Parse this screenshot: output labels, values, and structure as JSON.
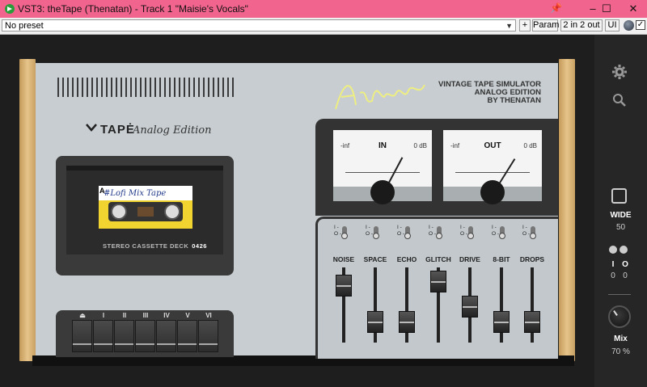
{
  "titlebar": {
    "title": "VST3: theTape (Thenatan) - Track 1 \"Maisie's Vocals\"",
    "minimize": "–",
    "maximize": "☐",
    "close": "✕",
    "pin": "📌"
  },
  "toolbar": {
    "preset": "No preset",
    "plus": "+",
    "param": "Param",
    "io": "2 in 2 out",
    "ui": "UI",
    "check": "✓"
  },
  "brand": {
    "logo": "TAPĖ",
    "edition": "Analog Edition",
    "signature": "AstroNommy",
    "vts_lines": [
      "VINTAGE TAPE SIMULATOR",
      "ANALOG EDITION",
      "BY THENATAN"
    ]
  },
  "deck": {
    "tape_label": "#Lofi Mix Tape",
    "side": "A",
    "caption": "STEREO CASSETTE DECK",
    "number": "0426"
  },
  "keys": [
    "⏏",
    "I",
    "II",
    "III",
    "IV",
    "V",
    "VI"
  ],
  "meters": [
    {
      "name": "IN",
      "min": "-inf",
      "max": "0 dB"
    },
    {
      "name": "OUT",
      "min": "-inf",
      "max": "0 dB"
    }
  ],
  "switch_labels": [
    "I -",
    "O -"
  ],
  "faders": [
    {
      "name": "NOISE",
      "level": 0.82
    },
    {
      "name": "SPACE",
      "level": 0.22
    },
    {
      "name": "ECHO",
      "level": 0.22
    },
    {
      "name": "GLITCH",
      "level": 0.88
    },
    {
      "name": "DRIVE",
      "level": 0.48
    },
    {
      "name": "8-BIT",
      "level": 0.22
    },
    {
      "name": "DROPS",
      "level": 0.22
    }
  ],
  "sidebar": {
    "wide_label": "WIDE",
    "wide_value": "50",
    "i_label": "I",
    "o_label": "O",
    "i_value": "0",
    "o_value": "0",
    "mix_label": "Mix",
    "mix_value": "70 %"
  },
  "colors": {
    "titlebar": "#f0648e",
    "panel": "#c7cdd0",
    "wood": "#d9b274"
  }
}
